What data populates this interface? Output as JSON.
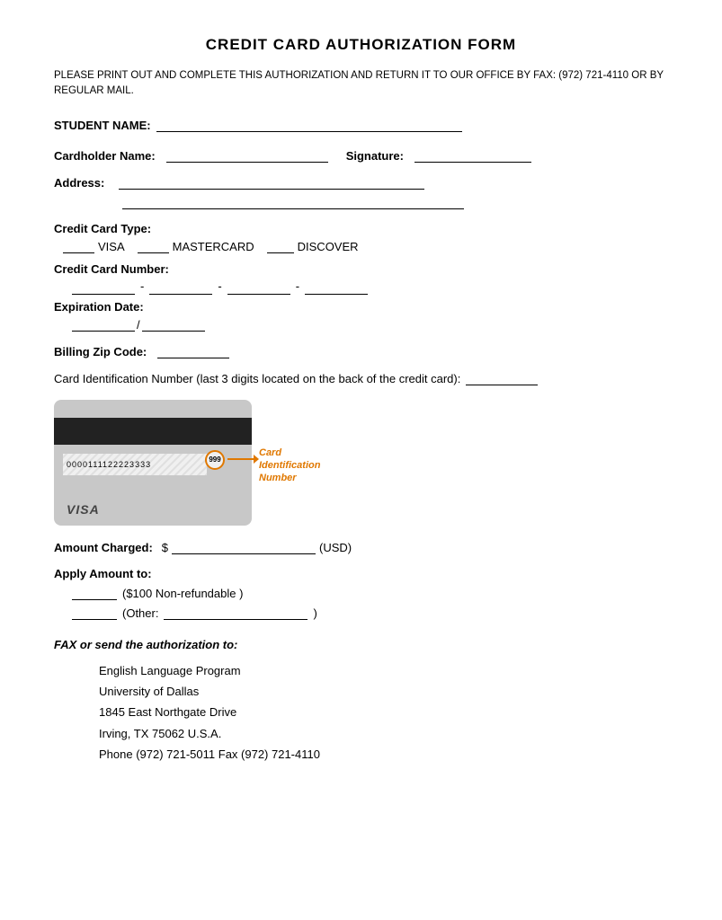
{
  "page": {
    "title": "CREDIT CARD AUTHORIZATION FORM",
    "instructions": "PLEASE PRINT OUT AND COMPLETE THIS AUTHORIZATION AND RETURN IT TO OUR OFFICE BY FAX: (972) 721-4110 OR BY REGULAR MAIL.",
    "student_name_label": "STUDENT NAME:",
    "cardholder_label": "Cardholder Name:",
    "signature_label": "Signature:",
    "address_label": "Address:",
    "credit_card_type_label": "Credit Card Type:",
    "visa_label": "VISA",
    "mastercard_label": "MASTERCARD",
    "discover_label": "DISCOVER",
    "card_number_label": "Credit Card Number:",
    "expiration_label": "Expiration Date:",
    "billing_zip_label": "Billing Zip Code:",
    "card_id_label": "Card Identification Number (last 3 digits located on the back of the credit card):",
    "card_number_display": "0000111122223333",
    "cvv_display": "999",
    "card_id_overlay_label": "Card Identification Number",
    "card_brand": "VISA",
    "amount_charged_label": "Amount Charged:",
    "dollar_sign": "$",
    "usd_label": "(USD)",
    "apply_amount_label": "Apply Amount to:",
    "non_refundable_label": "($100 Non-refundable )",
    "other_label": "(Other:",
    "other_close": ")",
    "fax_title": "FAX or send the authorization to:",
    "address_line1": "English Language Program",
    "address_line2": "University of Dallas",
    "address_line3": "1845 East Northgate Drive",
    "address_line4": "Irving, TX 75062     U.S.A.",
    "address_line5": "Phone (972) 721-5011   Fax (972) 721-4110"
  }
}
